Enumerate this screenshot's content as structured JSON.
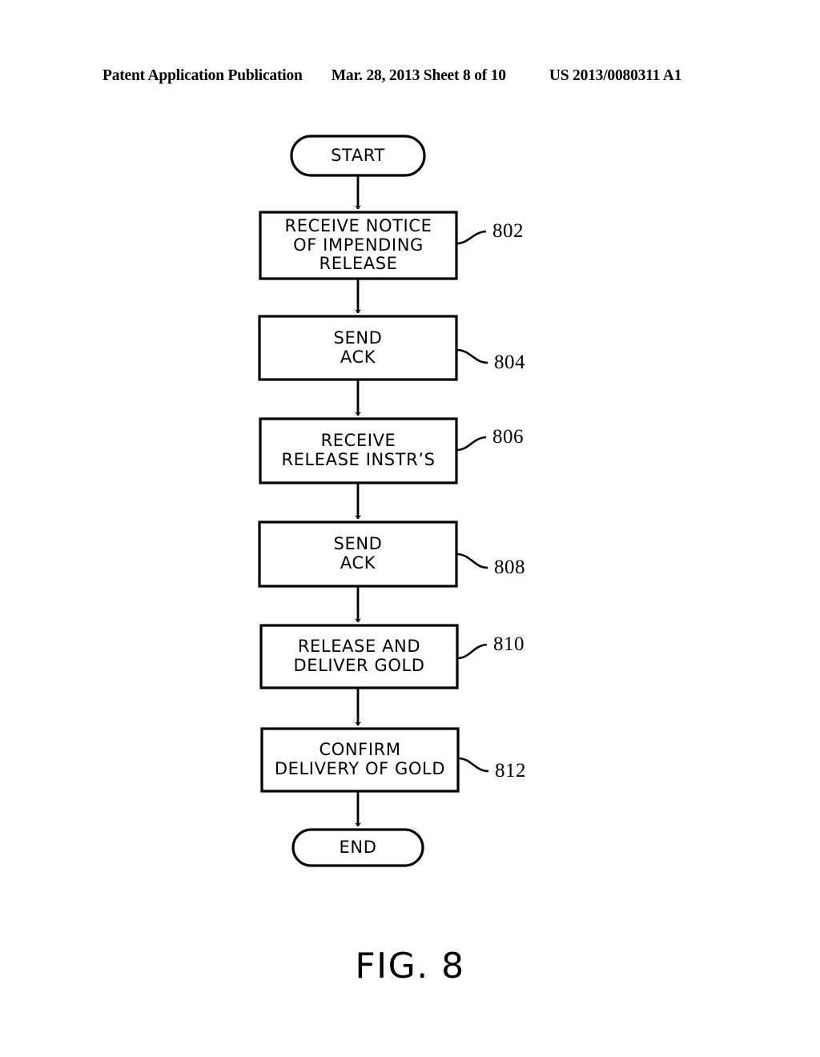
{
  "header": {
    "publication": "Patent Application Publication",
    "date_sheet": "Mar. 28, 2013  Sheet 8 of 10",
    "patent_number": "US 2013/0080311 A1"
  },
  "figure": {
    "caption": "FIG. 8",
    "line_color": "#000000",
    "fill_color": "#ffffff"
  },
  "flowchart": {
    "start": {
      "label": "START"
    },
    "end": {
      "label": "END"
    },
    "steps": [
      {
        "ref": "802",
        "lines": [
          "RECEIVE NOTICE",
          "OF IMPENDING",
          "RELEASE"
        ]
      },
      {
        "ref": "804",
        "lines": [
          "SEND",
          "ACK"
        ]
      },
      {
        "ref": "806",
        "lines": [
          "RECEIVE",
          "RELEASE INSTR’S"
        ]
      },
      {
        "ref": "808",
        "lines": [
          "SEND",
          "ACK"
        ]
      },
      {
        "ref": "810",
        "lines": [
          "RELEASE AND",
          "DELIVER GOLD"
        ]
      },
      {
        "ref": "812",
        "lines": [
          "CONFIRM",
          "DELIVERY OF GOLD"
        ]
      }
    ]
  }
}
